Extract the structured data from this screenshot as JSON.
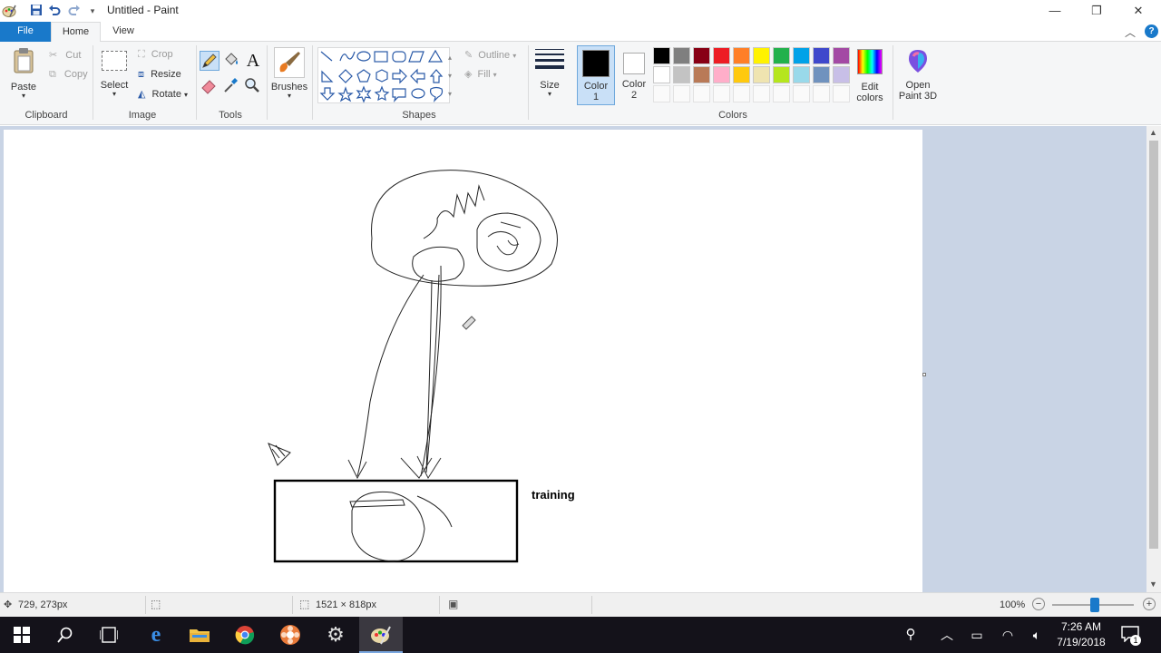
{
  "window": {
    "title": "Untitled - Paint"
  },
  "tabs": {
    "file": "File",
    "home": "Home",
    "view": "View"
  },
  "clipboard": {
    "paste": "Paste",
    "cut": "Cut",
    "copy": "Copy",
    "group": "Clipboard"
  },
  "image": {
    "select": "Select",
    "crop": "Crop",
    "resize": "Resize",
    "rotate": "Rotate",
    "group": "Image"
  },
  "tools": {
    "group": "Tools"
  },
  "brushes": {
    "label": "Brushes"
  },
  "shapes": {
    "group": "Shapes",
    "outline": "Outline",
    "fill": "Fill"
  },
  "size": {
    "label": "Size"
  },
  "colors": {
    "color1_a": "Color",
    "color1_b": "1",
    "color2_a": "Color",
    "color2_b": "2",
    "edit_a": "Edit",
    "edit_b": "colors",
    "group": "Colors",
    "color1": "#000000",
    "color2": "#ffffff",
    "row1": [
      "#000000",
      "#7f7f7f",
      "#880015",
      "#ed1c24",
      "#ff7f27",
      "#fff200",
      "#22b14c",
      "#00a2e8",
      "#3f48cc",
      "#a349a4"
    ],
    "row2": [
      "#ffffff",
      "#c3c3c3",
      "#b97a57",
      "#ffaec9",
      "#ffc90e",
      "#efe4b0",
      "#b5e61d",
      "#99d9ea",
      "#7092be",
      "#c8bfe7"
    ]
  },
  "paint3d": {
    "line1": "Open",
    "line2": "Paint 3D"
  },
  "canvas": {
    "text_label": "training"
  },
  "status": {
    "cursor": "729, 273px",
    "size": "1521 × 818px",
    "zoom": "100%"
  },
  "taskbar": {
    "time": "7:26 AM",
    "date": "7/19/2018",
    "notifications": "1"
  }
}
